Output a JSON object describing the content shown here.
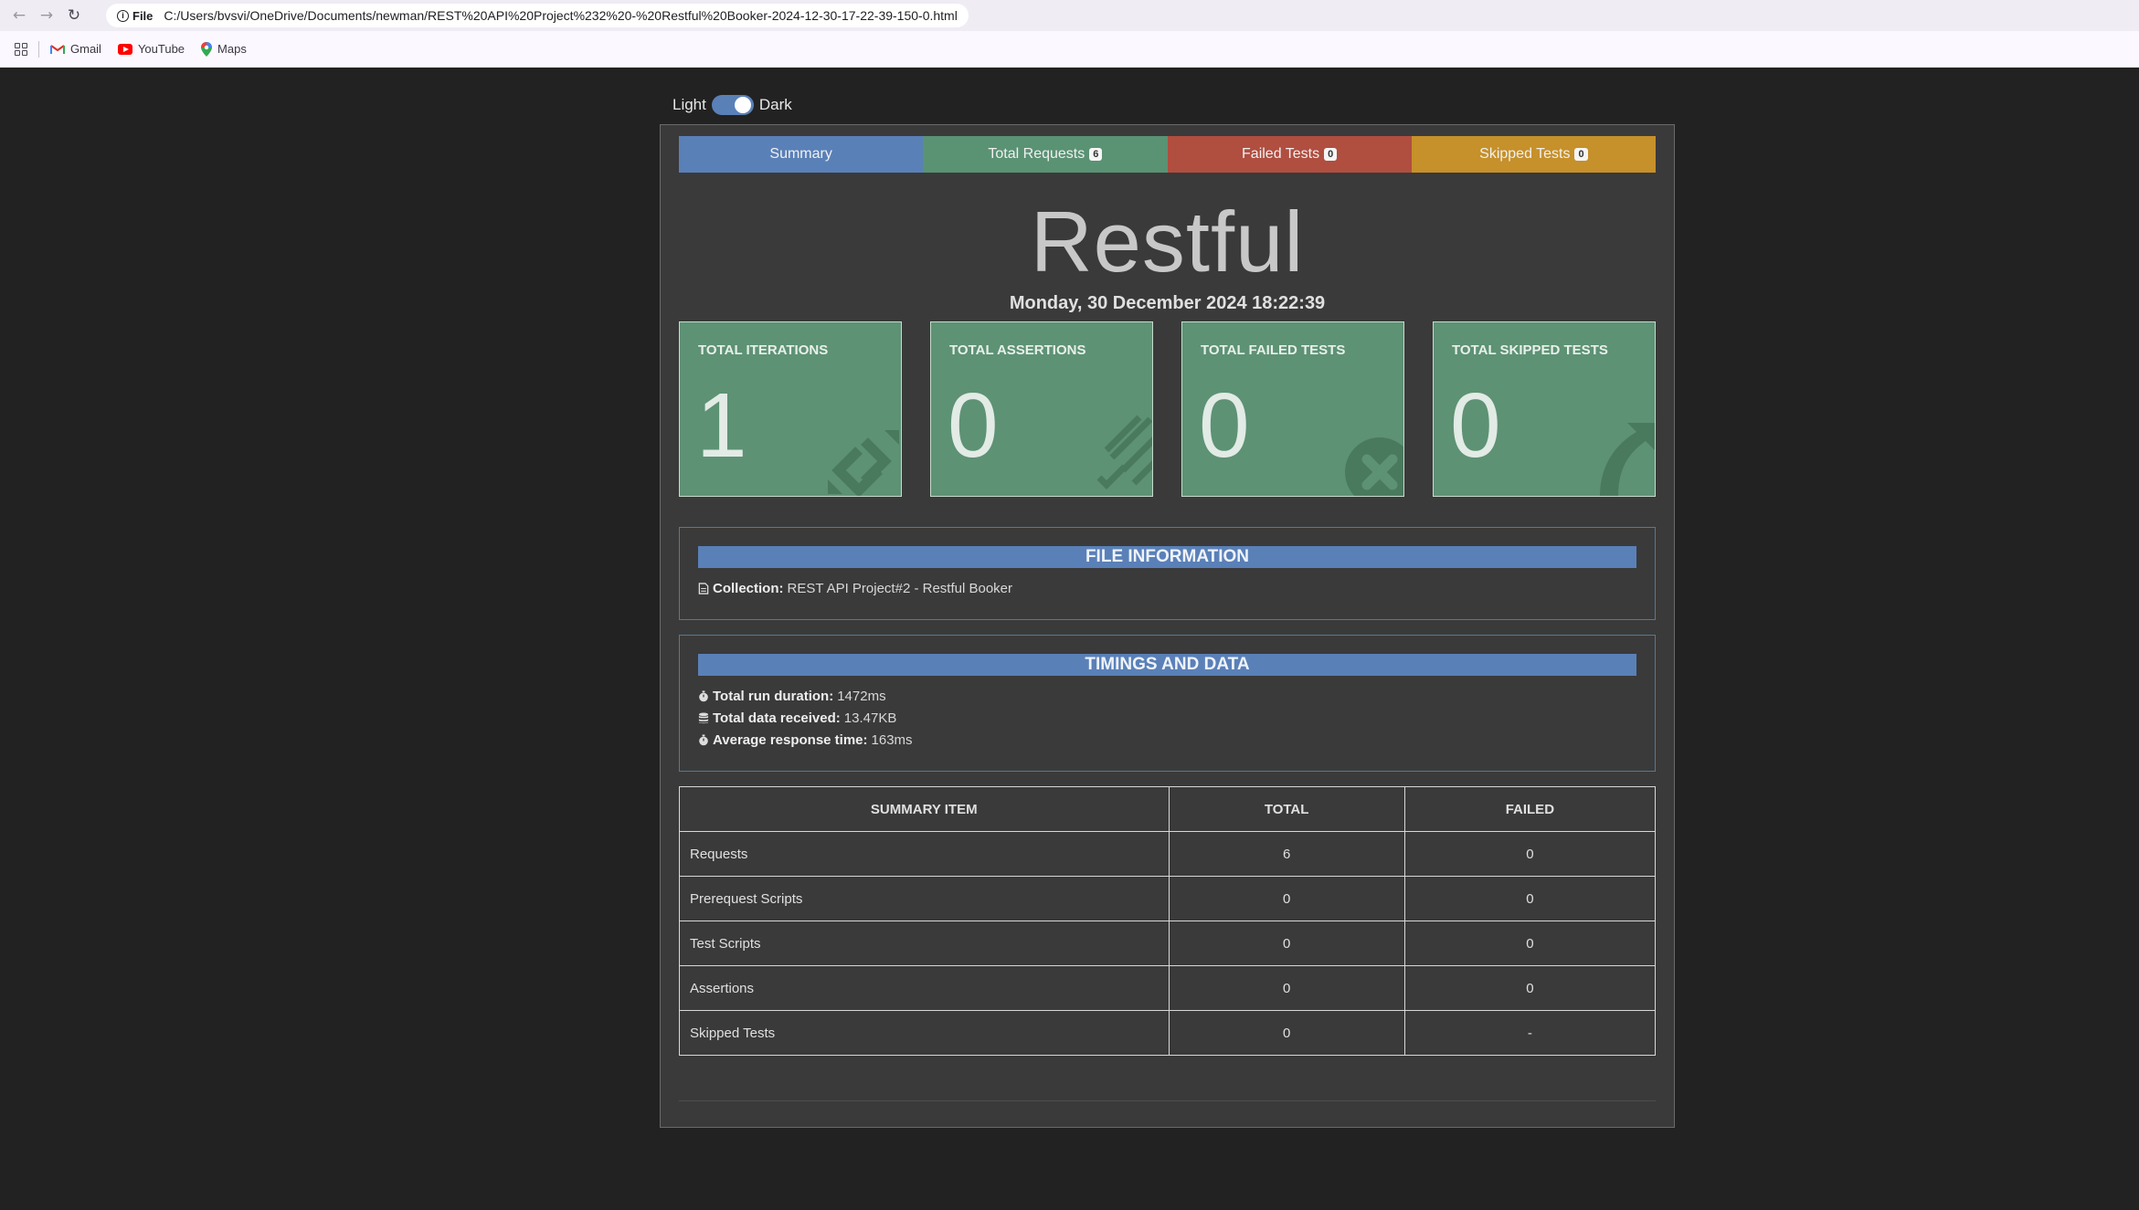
{
  "browser": {
    "nav_back": "←",
    "nav_forward": "→",
    "nav_reload": "↻",
    "info_label": "File",
    "url": "C:/Users/bvsvi/OneDrive/Documents/newman/REST%20API%20Project%232%20-%20Restful%20Booker-2024-12-30-17-22-39-150-0.html",
    "bookmarks": [
      {
        "label": "Gmail",
        "icon": "gmail-icon"
      },
      {
        "label": "YouTube",
        "icon": "youtube-icon"
      },
      {
        "label": "Maps",
        "icon": "maps-icon"
      }
    ]
  },
  "theme": {
    "light_label": "Light",
    "dark_label": "Dark",
    "dark_on": true
  },
  "tabs": {
    "summary": "Summary",
    "requests": "Total Requests",
    "requests_count": "6",
    "failed": "Failed Tests",
    "failed_count": "0",
    "skipped": "Skipped Tests",
    "skipped_count": "0"
  },
  "report": {
    "title": "Restful",
    "date": "Monday, 30 December 2024 18:22:39"
  },
  "stats": [
    {
      "label": "TOTAL ITERATIONS",
      "value": "1",
      "icon": "refresh-icon"
    },
    {
      "label": "TOTAL ASSERTIONS",
      "value": "0",
      "icon": "tasks-icon"
    },
    {
      "label": "TOTAL FAILED TESTS",
      "value": "0",
      "icon": "times-circle-icon"
    },
    {
      "label": "TOTAL SKIPPED TESTS",
      "value": "0",
      "icon": "share-icon"
    }
  ],
  "file_info": {
    "heading": "FILE INFORMATION",
    "collection_label": "Collection:",
    "collection_value": "REST API Project#2 - Restful Booker"
  },
  "timings": {
    "heading": "TIMINGS AND DATA",
    "duration_label": "Total run duration:",
    "duration_value": "1472ms",
    "data_label": "Total data received:",
    "data_value": "13.47KB",
    "avg_label": "Average response time:",
    "avg_value": "163ms"
  },
  "summary_table": {
    "headers": [
      "SUMMARY ITEM",
      "TOTAL",
      "FAILED"
    ],
    "rows": [
      [
        "Requests",
        "6",
        "0"
      ],
      [
        "Prerequest Scripts",
        "0",
        "0"
      ],
      [
        "Test Scripts",
        "0",
        "0"
      ],
      [
        "Assertions",
        "0",
        "0"
      ],
      [
        "Skipped Tests",
        "0",
        "-"
      ]
    ]
  },
  "colors": {
    "page_bg": "#222222",
    "card_bg": "#3a3a3a",
    "summary_tab": "#5a80b8",
    "requests_tab": "#5a9274",
    "failed_tab": "#b04e40",
    "skipped_tab": "#c6902a",
    "stat_card": "#5d9274"
  }
}
